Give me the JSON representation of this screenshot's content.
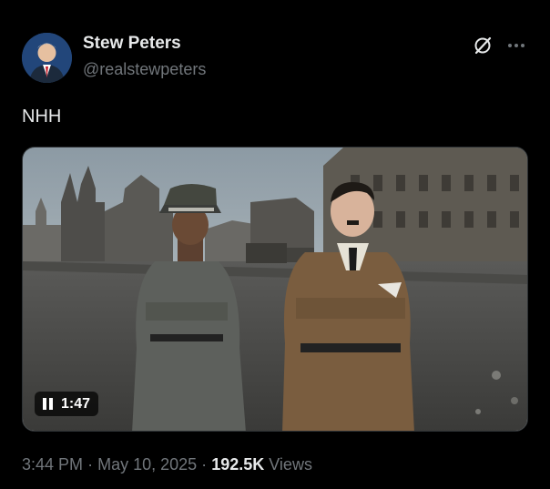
{
  "author": {
    "name": "Stew Peters",
    "handle": "@realstewpeters",
    "avatar_icon": "avatar-portrait"
  },
  "header_actions": {
    "grok_icon": "grok-slash-circle-icon",
    "more_icon": "more-horizontal-icon"
  },
  "post": {
    "text": "NHH"
  },
  "media": {
    "type": "video",
    "playback_icon": "pause-icon",
    "duration": "1:47"
  },
  "meta": {
    "time": "3:44 PM",
    "separator": "·",
    "date": "May 10, 2025",
    "views_count": "192.5K",
    "views_label": "Views"
  },
  "colors": {
    "background": "#000000",
    "primary_text": "#e7e9ea",
    "secondary_text": "#71767b"
  }
}
